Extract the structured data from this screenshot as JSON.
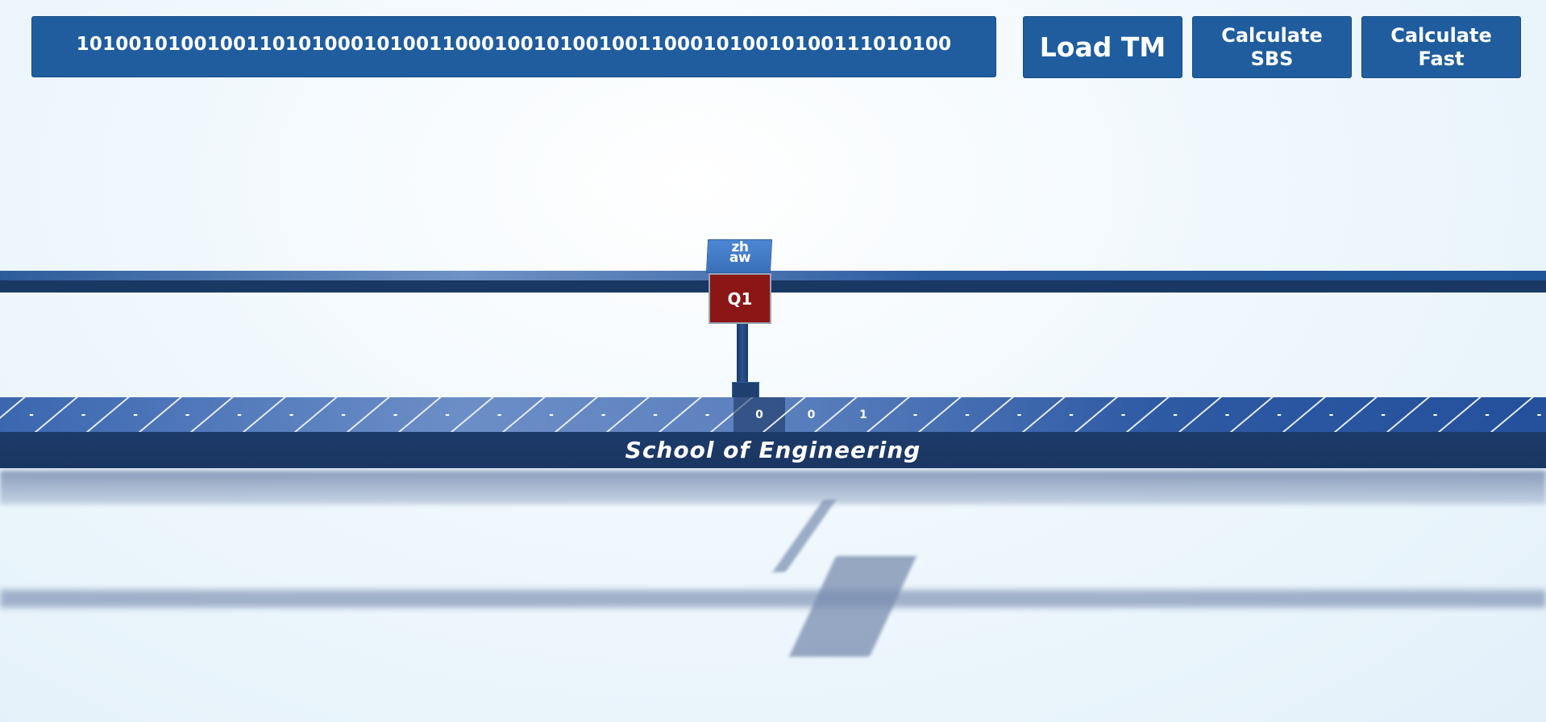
{
  "input": {
    "value": "1010010100100110101000101001100010010100100110001010010100111010100"
  },
  "buttons": {
    "load_tm": "Load TM",
    "calc_sbs": "Calculate\nSBS",
    "calc_fast": "Calculate\nFast"
  },
  "head": {
    "logo": "zh\naw",
    "state": "Q1"
  },
  "tape": {
    "cells": [
      "-",
      "-",
      "-",
      "-",
      "-",
      "-",
      "-",
      "-",
      "-",
      "-",
      "-",
      "-",
      "-",
      "-",
      "0",
      "0",
      "1",
      "-",
      "-",
      "-",
      "-",
      "-",
      "-",
      "-",
      "-",
      "-",
      "-",
      "-",
      "-",
      "-"
    ],
    "active_index": 14,
    "label": "School of Engineering"
  },
  "colors": {
    "button_bg": "#1f5d9e",
    "head_state_bg": "#8a1616",
    "tape_front": "#1a3561"
  }
}
